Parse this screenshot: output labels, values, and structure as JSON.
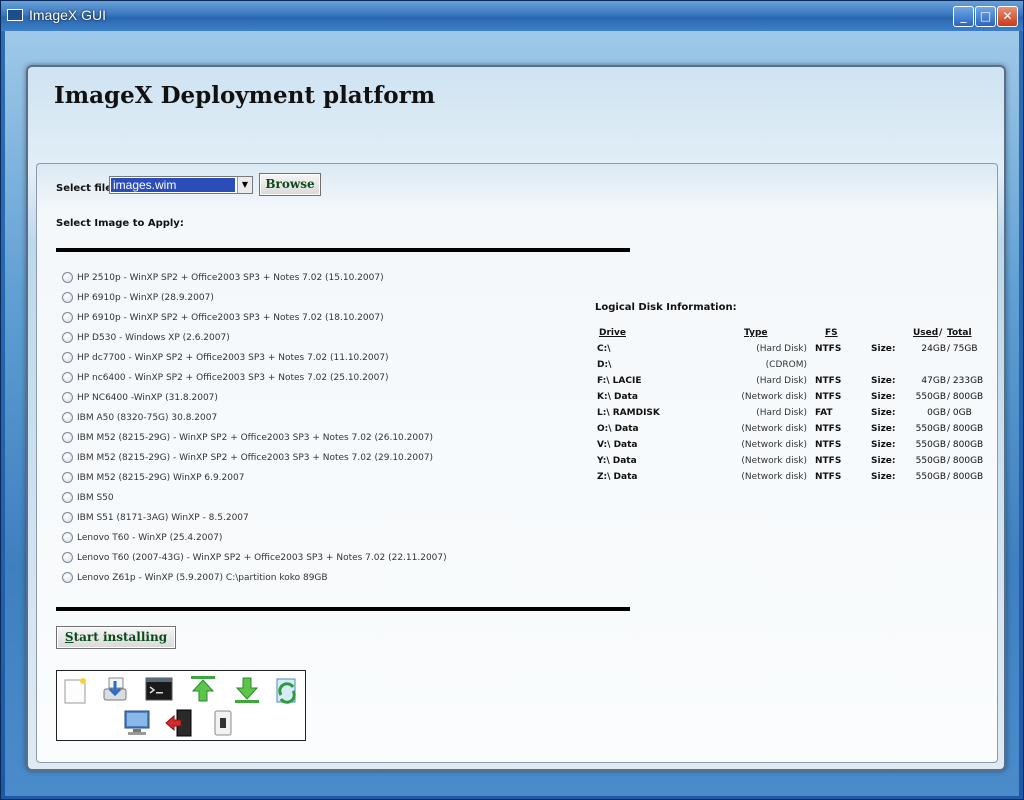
{
  "window": {
    "title": "ImageX GUI",
    "buttons": {
      "minimize": "_",
      "maximize": "□",
      "close": "✕"
    }
  },
  "header": {
    "title": "ImageX Deployment platform"
  },
  "file_selection": {
    "label": "Select file:",
    "selected": "images.wim",
    "browse_label": "Browse"
  },
  "images": {
    "label": "Select Image to Apply:",
    "items": [
      "HP 2510p - WinXP SP2 + Office2003 SP3 + Notes 7.02 (15.10.2007)",
      "HP 6910p - WinXP (28.9.2007)",
      "HP 6910p - WinXP SP2 + Office2003 SP3 + Notes 7.02 (18.10.2007)",
      "HP D530 - Windows XP (2.6.2007)",
      "HP dc7700 - WinXP SP2 + Office2003 SP3 + Notes 7.02 (11.10.2007)",
      "HP nc6400 - WinXP SP2 + Office2003 SP3 + Notes 7.02 (25.10.2007)",
      "HP NC6400 -WinXP (31.8.2007)",
      "IBM A50 (8320-75G) 30.8.2007",
      "IBM M52 (8215-29G) - WinXP SP2 + Office2003 SP3 + Notes 7.02 (26.10.2007)",
      "IBM M52 (8215-29G) - WinXP SP2 + Office2003 SP3 + Notes 7.02 (29.10.2007)",
      "IBM M52 (8215-29G) WinXP 6.9.2007",
      "IBM S50",
      "IBM S51 (8171-3AG) WinXP - 8.5.2007",
      "Lenovo T60 - WinXP (25.4.2007)",
      "Lenovo T60 (2007-43G) - WinXP SP2 + Office2003 SP3 + Notes 7.02 (22.11.2007)",
      "Lenovo Z61p - WinXP (5.9.2007) C:\\partition koko 89GB"
    ]
  },
  "start_button": {
    "hotkey": "S",
    "rest": "tart installing"
  },
  "disk_info": {
    "title": "Logical Disk Information:",
    "headers": {
      "drive": "Drive",
      "type": "Type",
      "fs": "FS",
      "used": "Used",
      "slash": "/",
      "total": "Total"
    },
    "size_label": "Size:",
    "rows": [
      {
        "drive": "C:\\",
        "type": "(Hard Disk)",
        "fs": "NTFS",
        "used": "24GB",
        "total": "75GB"
      },
      {
        "drive": "D:\\",
        "type": "(CDROM)",
        "fs": "",
        "used": "",
        "total": ""
      },
      {
        "drive": "F:\\ LACIE",
        "type": "(Hard Disk)",
        "fs": "NTFS",
        "used": "47GB",
        "total": "233GB"
      },
      {
        "drive": "K:\\ Data",
        "type": "(Network disk)",
        "fs": "NTFS",
        "used": "550GB",
        "total": "800GB"
      },
      {
        "drive": "L:\\ RAMDISK",
        "type": "(Hard Disk)",
        "fs": "FAT",
        "used": "0GB",
        "total": "0GB"
      },
      {
        "drive": "O:\\ Data",
        "type": "(Network disk)",
        "fs": "NTFS",
        "used": "550GB",
        "total": "800GB"
      },
      {
        "drive": "V:\\ Data",
        "type": "(Network disk)",
        "fs": "NTFS",
        "used": "550GB",
        "total": "800GB"
      },
      {
        "drive": "Y:\\ Data",
        "type": "(Network disk)",
        "fs": "NTFS",
        "used": "550GB",
        "total": "800GB"
      },
      {
        "drive": "Z:\\ Data",
        "type": "(Network disk)",
        "fs": "NTFS",
        "used": "550GB",
        "total": "800GB"
      }
    ]
  },
  "tools": [
    "new-document-icon",
    "install-download-icon",
    "command-prompt-icon",
    "upload-arrow-icon",
    "download-arrow-icon",
    "refresh-document-icon",
    "network-computer-icon",
    "exit-door-icon",
    "usb-drive-icon"
  ]
}
